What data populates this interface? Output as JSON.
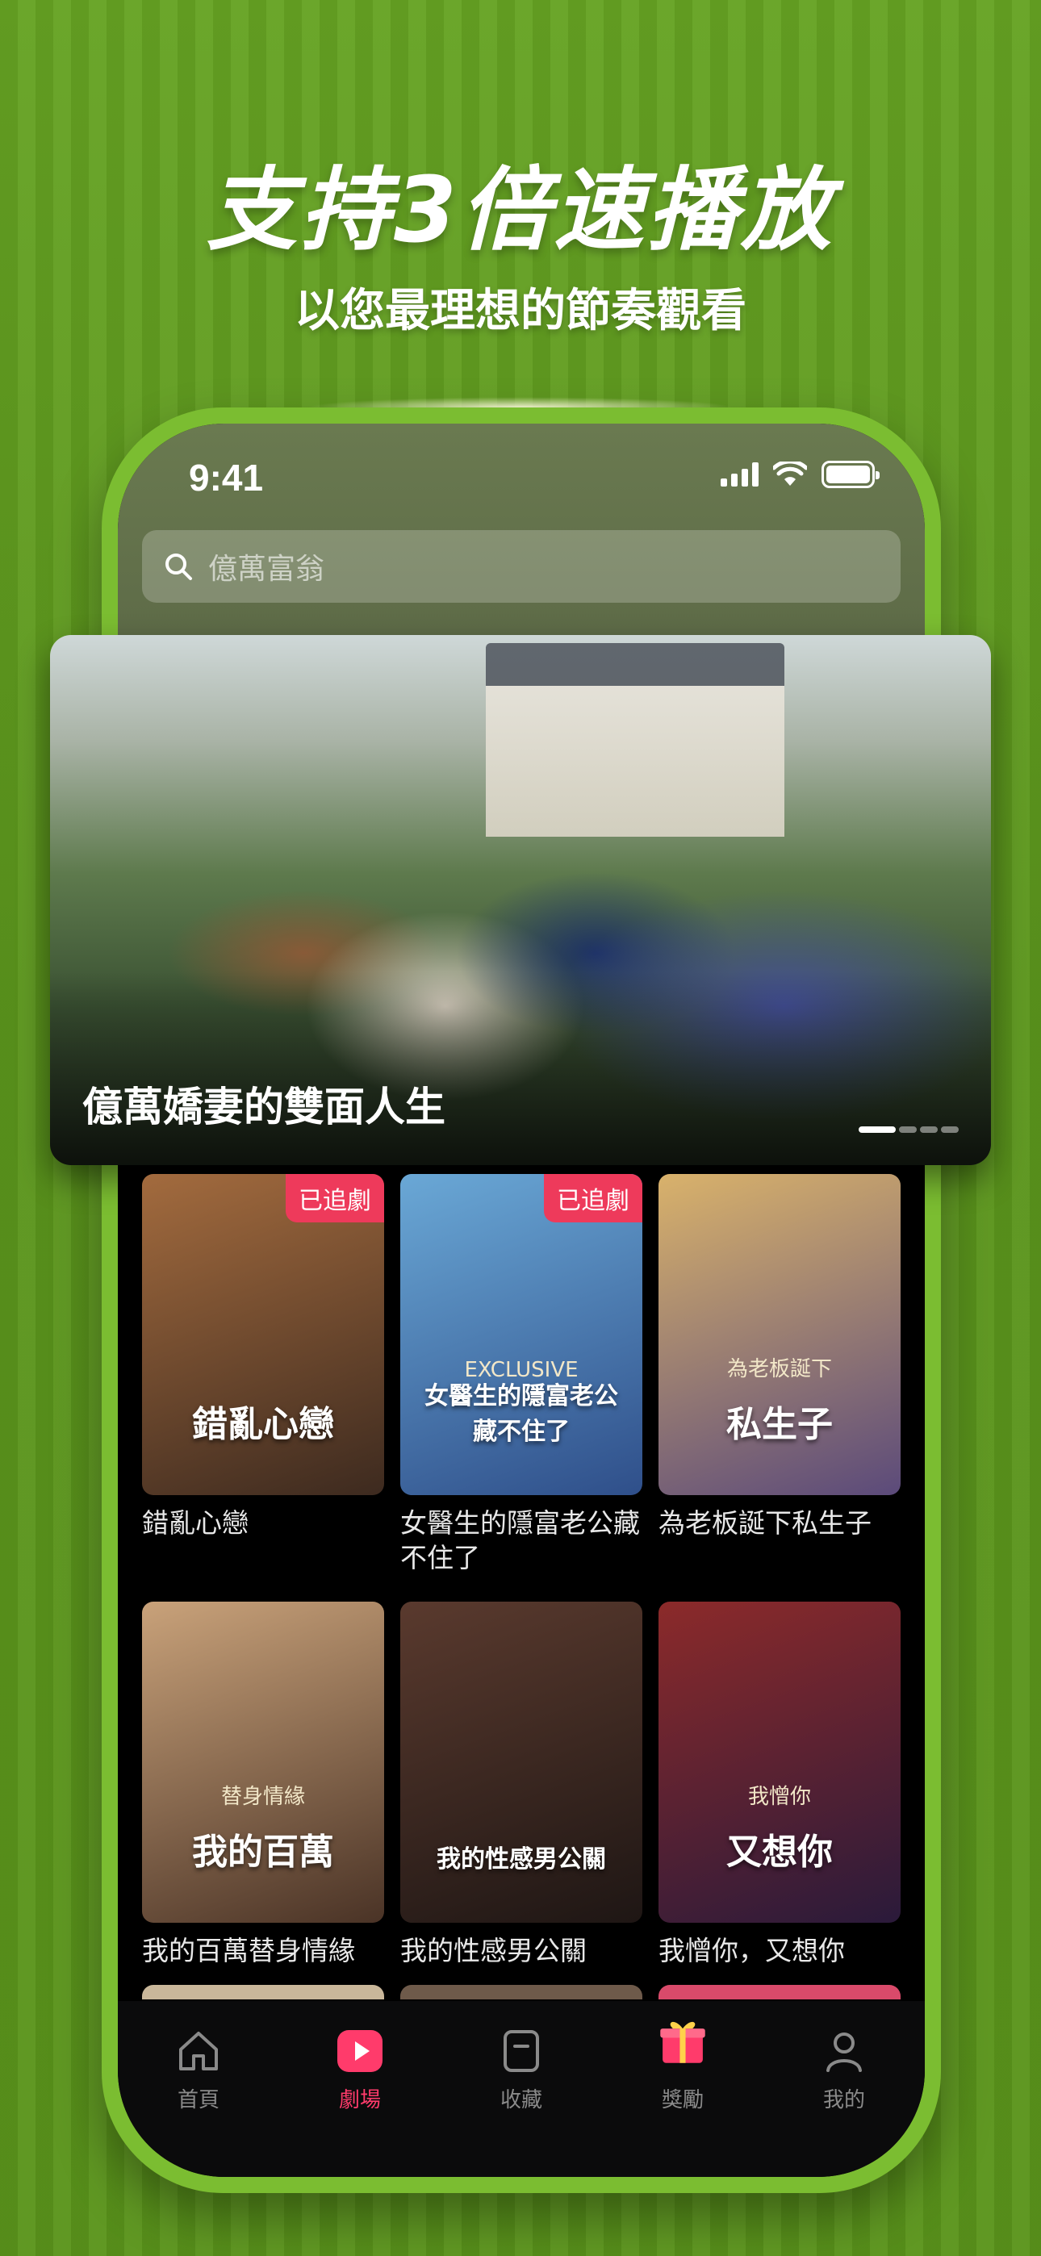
{
  "promo": {
    "headline": "支持3倍速播放",
    "subline": "以您最理想的節奏觀看"
  },
  "status_bar": {
    "time": "9:41"
  },
  "search": {
    "placeholder": "億萬富翁"
  },
  "hero": {
    "title": "億萬嬌妻的雙面人生",
    "carousel_position": 1,
    "carousel_total": 4
  },
  "shows": [
    {
      "title": "錯亂心戀",
      "poster_title": "錯亂心戀",
      "poster_sub": "",
      "badge": "已追劇",
      "colors": [
        "#a36b3e",
        "#3d2a1f"
      ]
    },
    {
      "title": "女醫生的隱富老公藏不住了",
      "poster_title": "女醫生的隱富老公藏不住了",
      "poster_sub": "EXCLUSIVE",
      "badge": "已追劇",
      "colors": [
        "#6aa8d6",
        "#2f4f8a"
      ]
    },
    {
      "title": "為老板誕下私生子",
      "poster_title": "私生子",
      "poster_sub": "為老板誕下",
      "badge": "",
      "colors": [
        "#d9b26b",
        "#5b4a7a"
      ]
    },
    {
      "title": "我的百萬替身情緣",
      "poster_title": "我的百萬",
      "poster_sub": "替身情緣",
      "badge": "",
      "colors": [
        "#c9a27a",
        "#4a3326"
      ]
    },
    {
      "title": "我的性感男公關",
      "poster_title": "我的性感男公關",
      "poster_sub": "",
      "badge": "",
      "colors": [
        "#5a3a2e",
        "#1e1614"
      ]
    },
    {
      "title": "我憎你，又想你",
      "poster_title": "又想你",
      "poster_sub": "我憎你",
      "badge": "",
      "colors": [
        "#8c2a2a",
        "#2a1a3a"
      ]
    }
  ],
  "peek_colors": [
    "#c9b79a",
    "#6e5a4a",
    "#d94a6a"
  ],
  "tabbar": {
    "tabs": [
      {
        "label": "首頁",
        "icon": "home-icon",
        "active": false
      },
      {
        "label": "劇場",
        "icon": "play-icon",
        "active": true
      },
      {
        "label": "收藏",
        "icon": "bookmark-icon",
        "active": false
      },
      {
        "label": "獎勵",
        "icon": "gift-icon",
        "active": false
      },
      {
        "label": "我的",
        "icon": "profile-icon",
        "active": false
      }
    ]
  },
  "colors": {
    "accent": "#ff3b6b",
    "badge": "#ee3a5b",
    "frame": "#7bbd31",
    "background": "#5f9a1f"
  }
}
